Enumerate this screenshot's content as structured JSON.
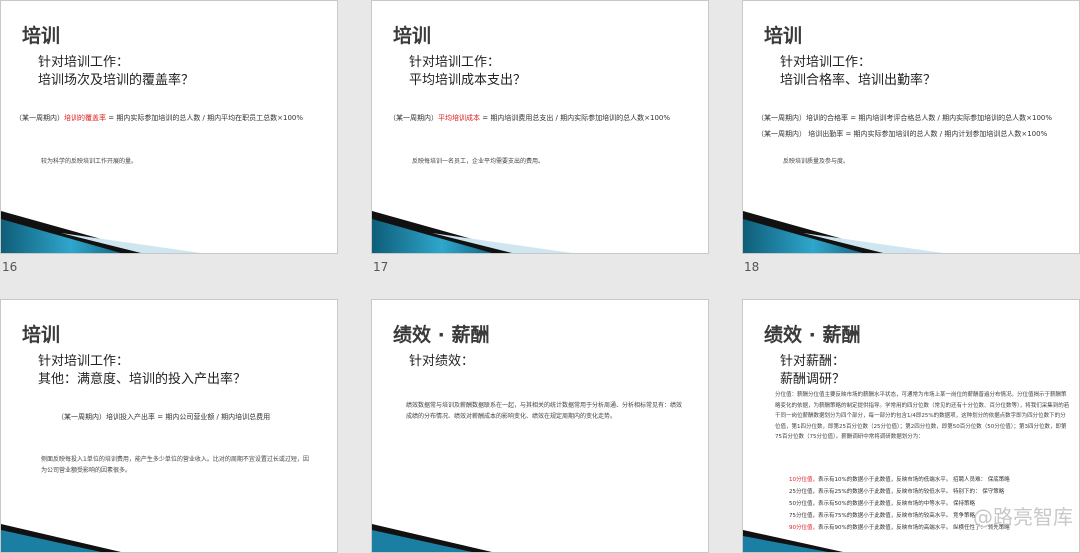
{
  "slides": [
    {
      "num": "16",
      "title": "培训",
      "sub1": "针对培训工作：",
      "sub2": "培训场次及培训的覆盖率？",
      "formula_prefix": "（某一周期内）",
      "formula_red": "培训的覆盖率",
      "formula_rest": " = 期内实际参加培训的总人数 / 期内平均在职员工总数×100%",
      "note": "较为科学的反映培训工作开展的量。"
    },
    {
      "num": "17",
      "title": "培训",
      "sub1": "针对培训工作：",
      "sub2": "平均培训成本支出？",
      "formula_prefix": "（某一周期内）",
      "formula_red": "平均培训成本",
      "formula_rest": " = 期内培训费用总支出 / 期内实际参加培训的总人数×100%",
      "note": "反映每培训一名员工，企业平均需要支出的费用。"
    },
    {
      "num": "18",
      "title": "培训",
      "sub1": "针对培训工作：",
      "sub2": "培训合格率、培训出勤率？",
      "formula_line1": "（某一周期内）培训的合格率 = 期内培训考评合格总人数 / 期内实际参加培训的总人数×100%",
      "formula_line2": "（某一周期内）  培训出勤率  = 期内实际参加培训的总人数 / 期内计划参加培训总人数×100%",
      "note": "反映培训质量及参与度。"
    },
    {
      "num": "",
      "title": "培训",
      "sub1": "针对培训工作：",
      "sub2": "其他：满意度、培训的投入产出率？",
      "formula_line1": "（某一周期内）培训投入产出率 = 期内公司营业额 / 期内培训总费用",
      "note": "侧面反映每投入1单位的培训费用，能产生多少单位的营业收入。比对的周期不宜设置过长或过短，因为公司营业额受影响的因素很多。"
    },
    {
      "num": "",
      "title": "绩效 · 薪酬",
      "sub1": "针对绩效：",
      "note": "绩效数据常与培训及薪酬数据联系在一起，与其相关的统计数据常用于分析周通、分析相标常见有：绩效成绩的分布情况、绩效对薪酬成本的影响变化、绩效在规定周期内的变化走势。"
    },
    {
      "num": "",
      "title": "绩效 · 薪酬",
      "sub1": "针对薪酬：",
      "sub2": "薪酬调研？",
      "para": "分位值：薪酬分位值主要反映市场的薪酬水平状态，可通常为市场上某一岗位的薪酬普遍分布情况。分位值揭示于薪酬策略变化的依据，为薪酬策略的制定提供指导。学常用的四分位数（常见的还有十分位数、百分位数等），将我们采集到的若干同一岗位薪酬数据划分为四个部分，每一部分的包含1/4即25%的数据项，这种划分的依据点数字即为四分位数下的分位值，第1四分位数，即第25百分位数（25分位值）；第2四分位数，即第50百分位数（50分位值）；第3四分位数，即第75百分位数（75分位值）。薪酬调研中常将调研数据划分为：",
      "tiers": [
        {
          "red": "10分位值，",
          "text": "表示有10%的数据小于此数值，反映市场的低端水平。  招聘人员难：   保底策略"
        },
        {
          "red": "",
          "text": "25分位值，表示有25%的数据小于此数值，反映市场的较低水平。  特别下的：   保守策略"
        },
        {
          "red": "",
          "text": "50分位值，表示有50%的数据小于此数值，反映市场的中等水平。         保持策略"
        },
        {
          "red": "",
          "text": "75分位值，表示有75%的数据小于此数值，反映市场的较高水平。         竞争策略"
        },
        {
          "red": "90分位值，",
          "text": "表示有90%的数据小于此数值，反映市场的高端水平。  纵横任性了：  领先策略"
        }
      ],
      "watermark": "@路亮智库"
    }
  ]
}
